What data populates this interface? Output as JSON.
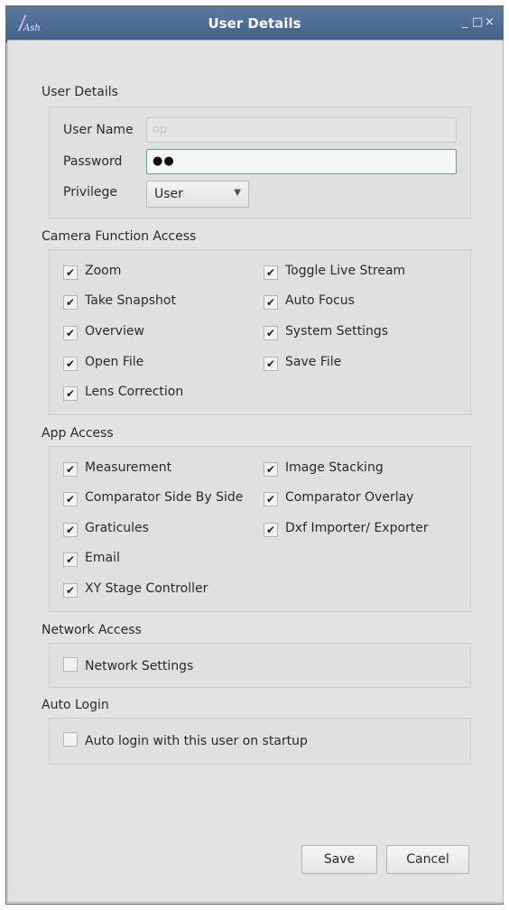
{
  "window": {
    "title": "User Details",
    "app_icon_text": "Ash",
    "controls": {
      "minimize": "_",
      "maximize": "□",
      "close": "×"
    }
  },
  "user_details": {
    "section_title": "User Details",
    "username_label": "User Name",
    "username_placeholder": "op",
    "password_label": "Password",
    "password_value": "●●",
    "privilege_label": "Privilege",
    "privilege_value": "User"
  },
  "camera_access": {
    "section_title": "Camera Function Access",
    "items": [
      {
        "label": "Zoom",
        "checked": true
      },
      {
        "label": "Toggle Live Stream",
        "checked": true
      },
      {
        "label": "Take Snapshot",
        "checked": true
      },
      {
        "label": "Auto Focus",
        "checked": true
      },
      {
        "label": "Overview",
        "checked": true
      },
      {
        "label": "System Settings",
        "checked": true
      },
      {
        "label": "Open File",
        "checked": true
      },
      {
        "label": "Save File",
        "checked": true
      },
      {
        "label": "Lens Correction",
        "checked": true
      }
    ]
  },
  "app_access": {
    "section_title": "App Access",
    "items": [
      {
        "label": "Measurement",
        "checked": true
      },
      {
        "label": "Image Stacking",
        "checked": true
      },
      {
        "label": "Comparator Side By Side",
        "checked": true
      },
      {
        "label": "Comparator Overlay",
        "checked": true
      },
      {
        "label": "Graticules",
        "checked": true
      },
      {
        "label": "Dxf Importer/ Exporter",
        "checked": true
      },
      {
        "label": "Email",
        "checked": true
      },
      {
        "label": "XY Stage Controller",
        "checked": true
      }
    ]
  },
  "network_access": {
    "section_title": "Network Access",
    "items": [
      {
        "label": "Network Settings",
        "checked": false
      }
    ]
  },
  "auto_login": {
    "section_title": "Auto Login",
    "items": [
      {
        "label": "Auto login with this user on startup",
        "checked": false
      }
    ]
  },
  "buttons": {
    "save": "Save",
    "cancel": "Cancel"
  }
}
